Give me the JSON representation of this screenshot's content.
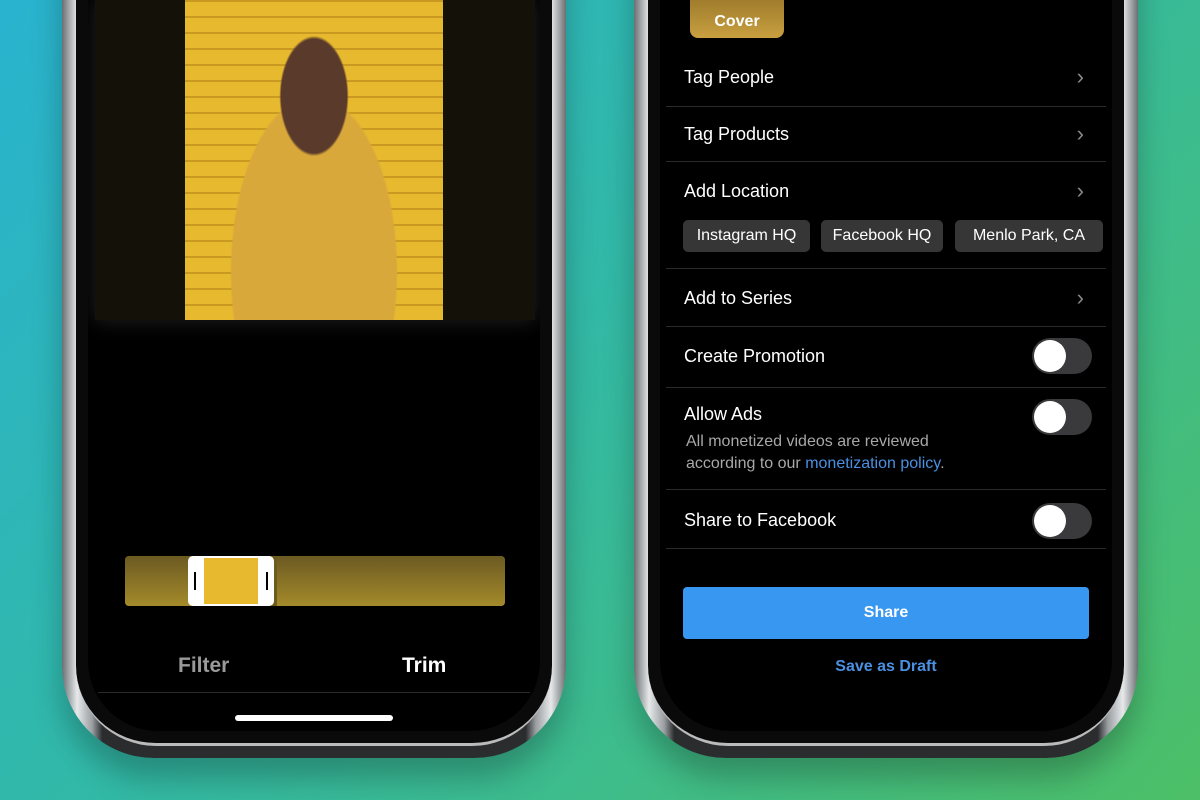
{
  "left_phone": {
    "tabs": [
      {
        "label": "Filter",
        "active": false
      },
      {
        "label": "Trim",
        "active": true
      }
    ]
  },
  "right_phone": {
    "cover_label": "Cover",
    "rows": {
      "tag_people": "Tag People",
      "tag_products": "Tag Products",
      "add_location": "Add Location",
      "add_to_series": "Add to Series",
      "create_promotion": "Create Promotion",
      "allow_ads": "Allow Ads",
      "allow_ads_desc_1": "All monetized videos are reviewed",
      "allow_ads_desc_2": "according to our ",
      "monetization_link": "monetization policy",
      "allow_ads_desc_end": ".",
      "share_to_facebook": "Share to Facebook"
    },
    "location_chips": [
      "Instagram HQ",
      "Facebook HQ",
      "Menlo Park, CA"
    ],
    "toggles": {
      "create_promotion": false,
      "allow_ads": false,
      "share_to_facebook": false
    },
    "share_button": "Share",
    "save_draft": "Save as Draft"
  },
  "colors": {
    "accent": "#3897f0",
    "link": "#4a90e2",
    "video_yellow": "#e7b92f"
  }
}
